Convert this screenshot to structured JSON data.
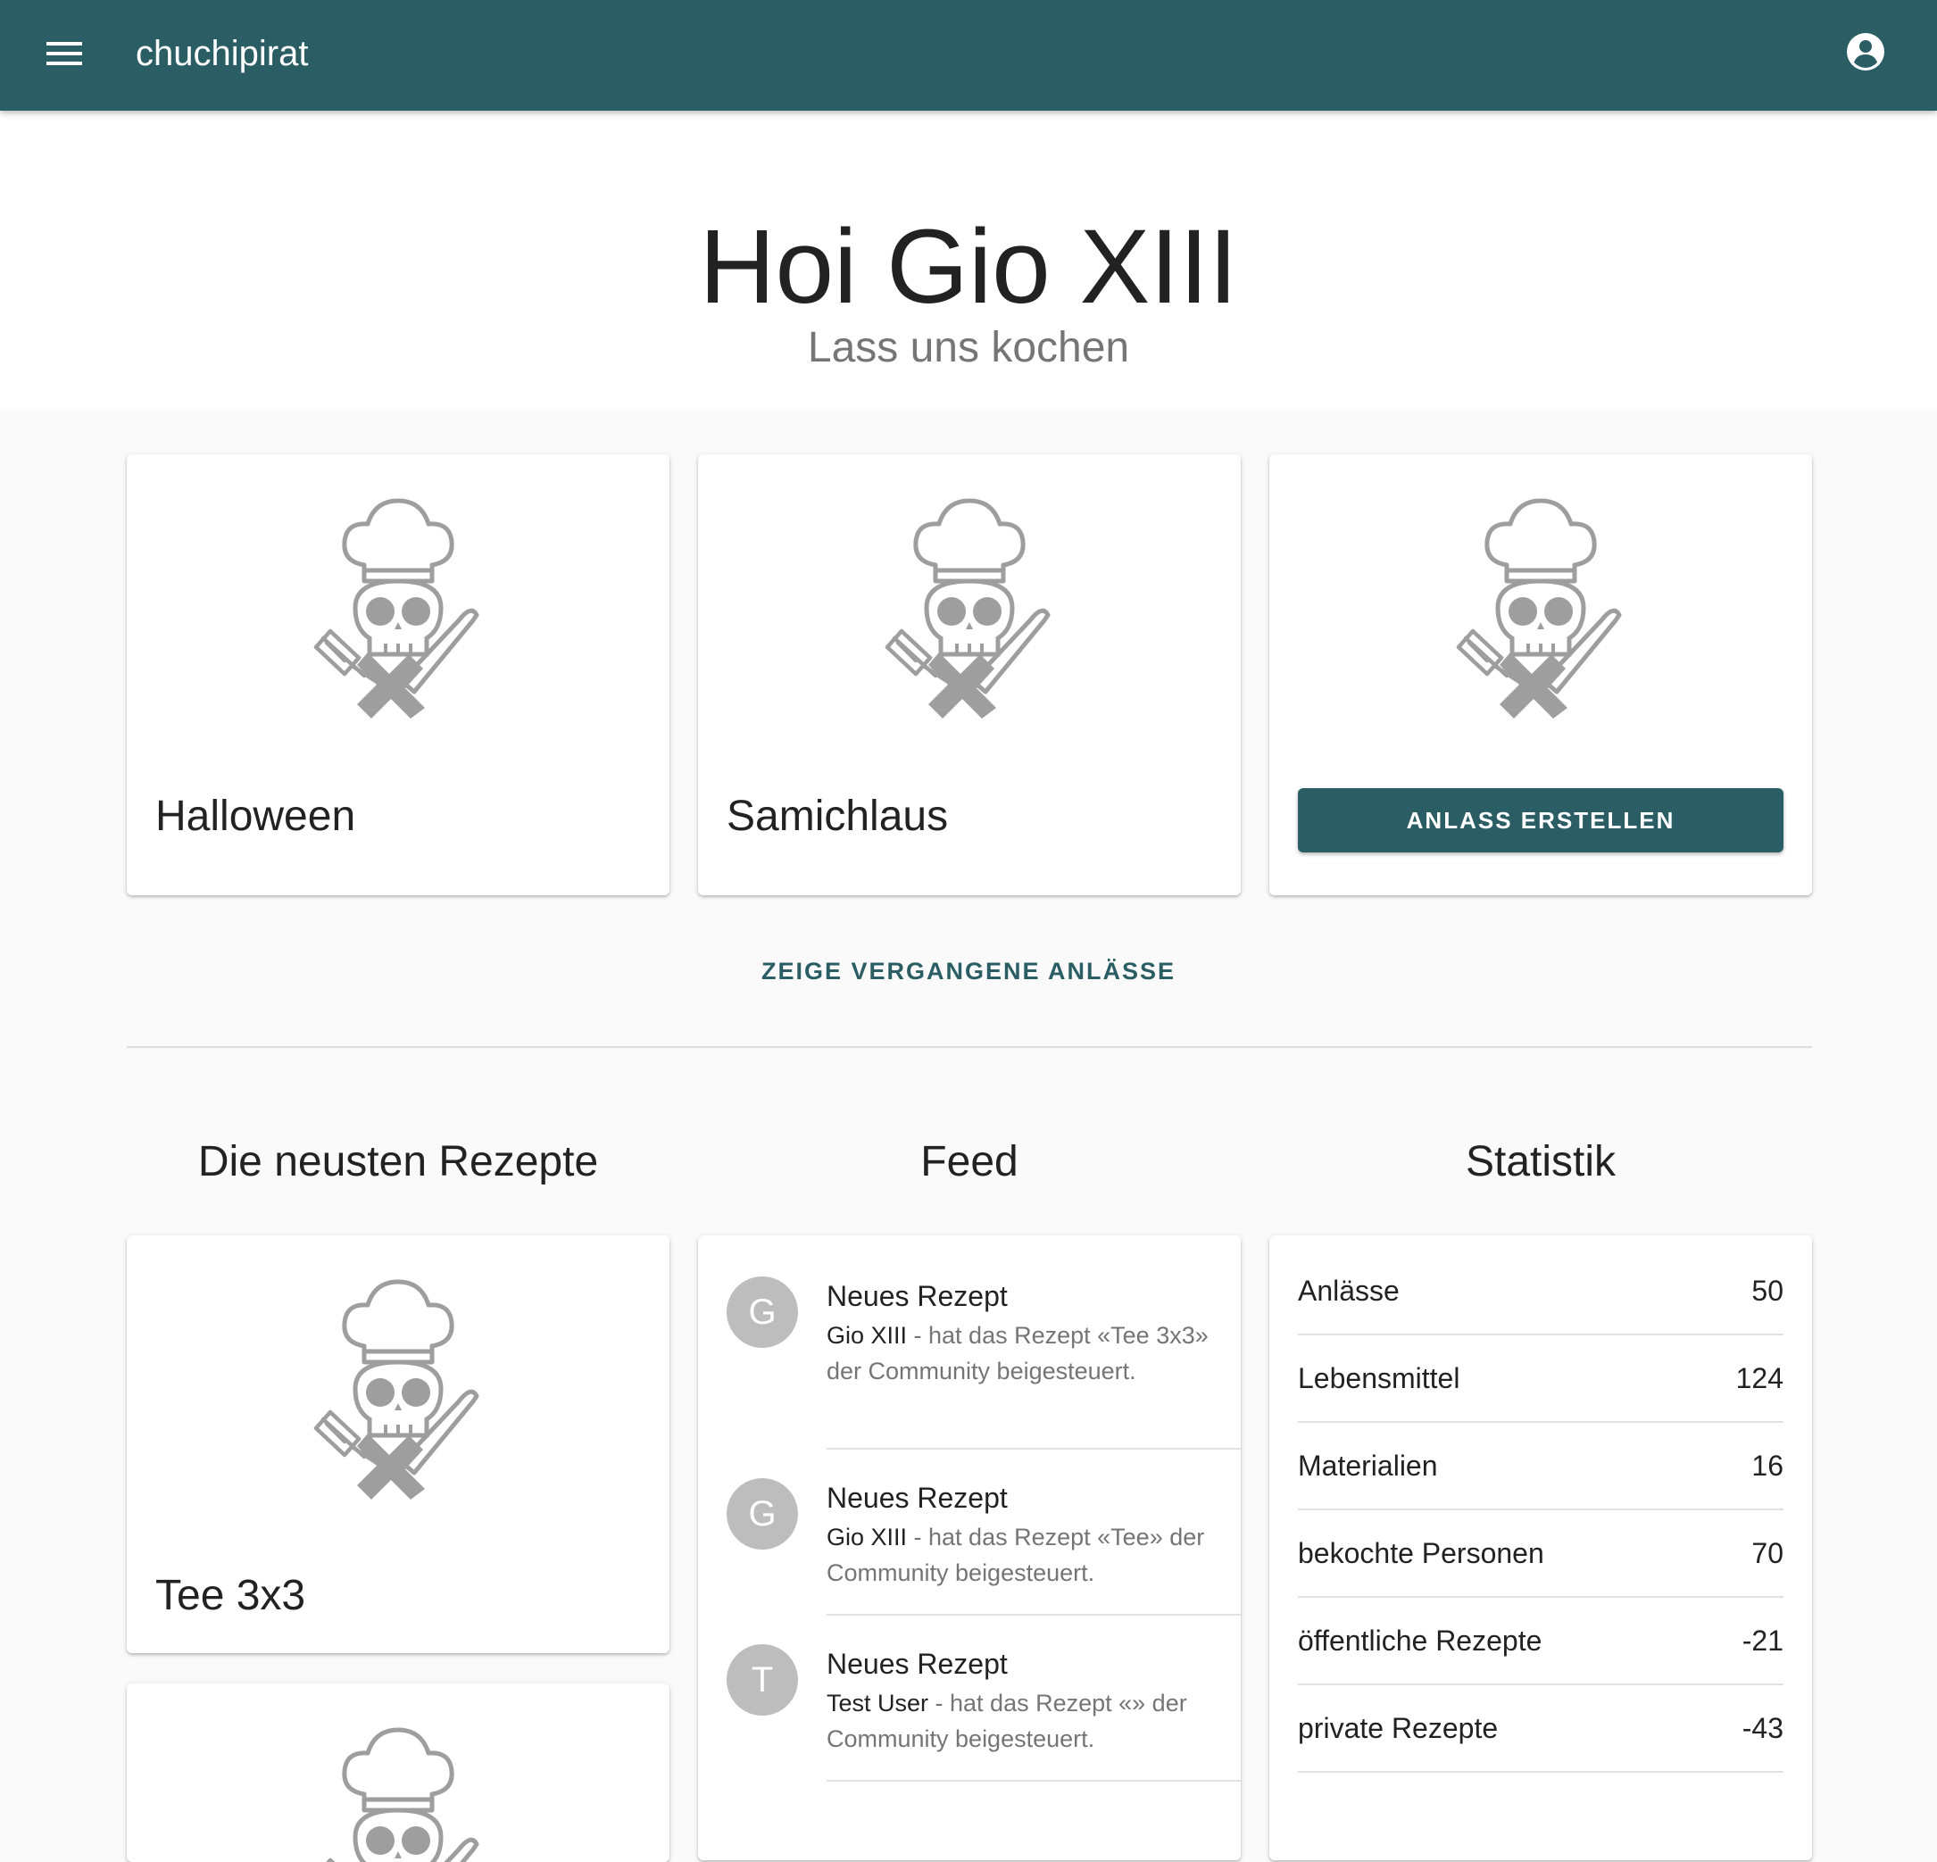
{
  "appbar": {
    "title": "chuchipirat",
    "menu_icon": "menu-icon",
    "account_icon": "account-circle-icon",
    "color": "#2a5d64"
  },
  "hero": {
    "title": "Hoi Gio XIII",
    "subtitle": "Lass uns kochen"
  },
  "events": [
    {
      "name": "Halloween"
    },
    {
      "name": "Samichlaus"
    }
  ],
  "create_event": {
    "button_label": "ANLASS ERSTELLEN"
  },
  "past_events_link": "ZEIGE VERGANGENE ANLÄSSE",
  "sections": {
    "recipes_heading": "Die neusten Rezepte",
    "feed_heading": "Feed",
    "stats_heading": "Statistik"
  },
  "recipes": [
    {
      "name": "Tee 3x3"
    }
  ],
  "feed": [
    {
      "initial": "G",
      "title": "Neues Rezept",
      "user": "Gio XIII",
      "text": " - hat das Rezept «Tee 3x3» der Community beigesteuert."
    },
    {
      "initial": "G",
      "title": "Neues Rezept",
      "user": "Gio XIII",
      "text": " - hat das Rezept «Tee» der Community beigesteuert."
    },
    {
      "initial": "T",
      "title": "Neues Rezept",
      "user": "Test User",
      "text": " - hat das Rezept «» der Community beigesteuert."
    }
  ],
  "stats": [
    {
      "label": "Anlässe",
      "value": "50"
    },
    {
      "label": "Lebensmittel",
      "value": "124"
    },
    {
      "label": "Materialien",
      "value": "16"
    },
    {
      "label": "bekochte Personen",
      "value": "70"
    },
    {
      "label": "öffentliche Rezepte",
      "value": "-21"
    },
    {
      "label": "private Rezepte",
      "value": "-43"
    }
  ],
  "illustration_icon": "chef-skull-knife-fork-icon"
}
